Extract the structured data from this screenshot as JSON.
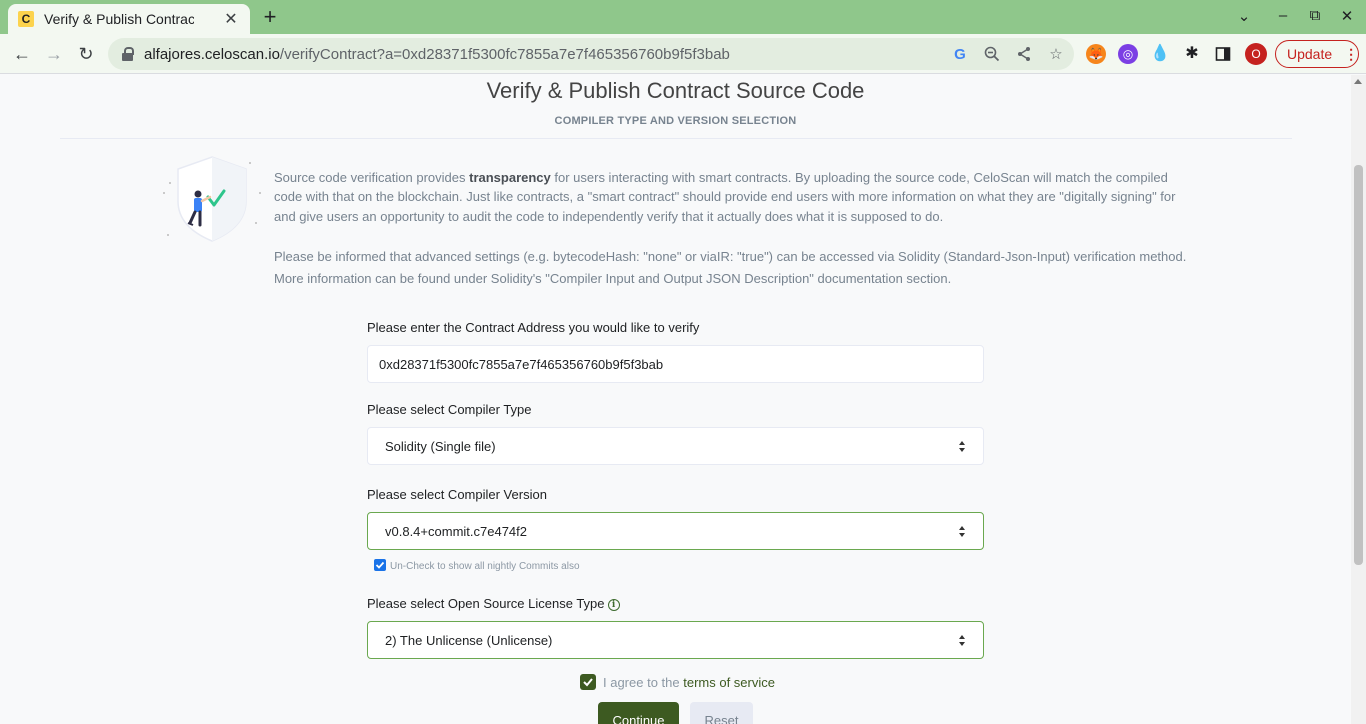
{
  "browser": {
    "tab_title": "Verify & Publish Contract Source Code | CeloScan",
    "tab_favicon_letter": "C",
    "url_host": "alfajores.celoscan.io",
    "url_path": "/verifyContract?a=0xd28371f5300fc7855a7e7f465356760b9f5f3bab",
    "profile_initial": "O",
    "update_label": "Update",
    "icons": [
      "back-icon",
      "forward-icon",
      "reload-icon",
      "lock-icon",
      "google-icon",
      "zoom-out-icon",
      "share-icon",
      "star-icon",
      "metamask-icon",
      "extension-icon",
      "droplet-icon",
      "puzzle-icon",
      "sidepanel-icon",
      "more-icon"
    ]
  },
  "page": {
    "title": "Verify & Publish Contract Source Code",
    "subtitle": "COMPILER TYPE AND VERSION SELECTION",
    "intro_pre": "Source code verification provides ",
    "intro_bold": "transparency",
    "intro_post": " for users interacting with smart contracts. By uploading the source code, CeloScan will match the compiled code with that on the blockchain. Just like contracts, a \"smart contract\" should provide end users with more information on what they are \"digitally signing\" for and give users an opportunity to audit the code to independently verify that it actually does what it is supposed to do.",
    "intro2": "Please be informed that advanced settings (e.g. bytecodeHash: \"none\" or viaIR: \"true\") can be accessed via Solidity (Standard-Json-Input) verification method. More information can be found under Solidity's \"Compiler Input and Output JSON Description\" documentation section."
  },
  "form": {
    "address_label": "Please enter the Contract Address you would like to verify",
    "address_value": "0xd28371f5300fc7855a7e7f465356760b9f5f3bab",
    "compiler_type_label": "Please select Compiler Type",
    "compiler_type_value": "Solidity (Single file)",
    "compiler_version_label": "Please select Compiler Version",
    "compiler_version_value": "v0.8.4+commit.c7e474f2",
    "nightly_label": "Un-Check to show all nightly Commits also",
    "license_label": "Please select Open Source License Type",
    "license_value": "2) The Unlicense (Unlicense)",
    "agree_prefix": "I agree to the ",
    "agree_link": "terms of service",
    "continue_label": "Continue",
    "reset_label": "Reset"
  },
  "colors": {
    "tabstrip": "#8fc78b",
    "toolbar": "#f3f8f1",
    "primary": "#3d5a21",
    "valid_border": "#6aa84f",
    "profile": "#c5221f"
  }
}
